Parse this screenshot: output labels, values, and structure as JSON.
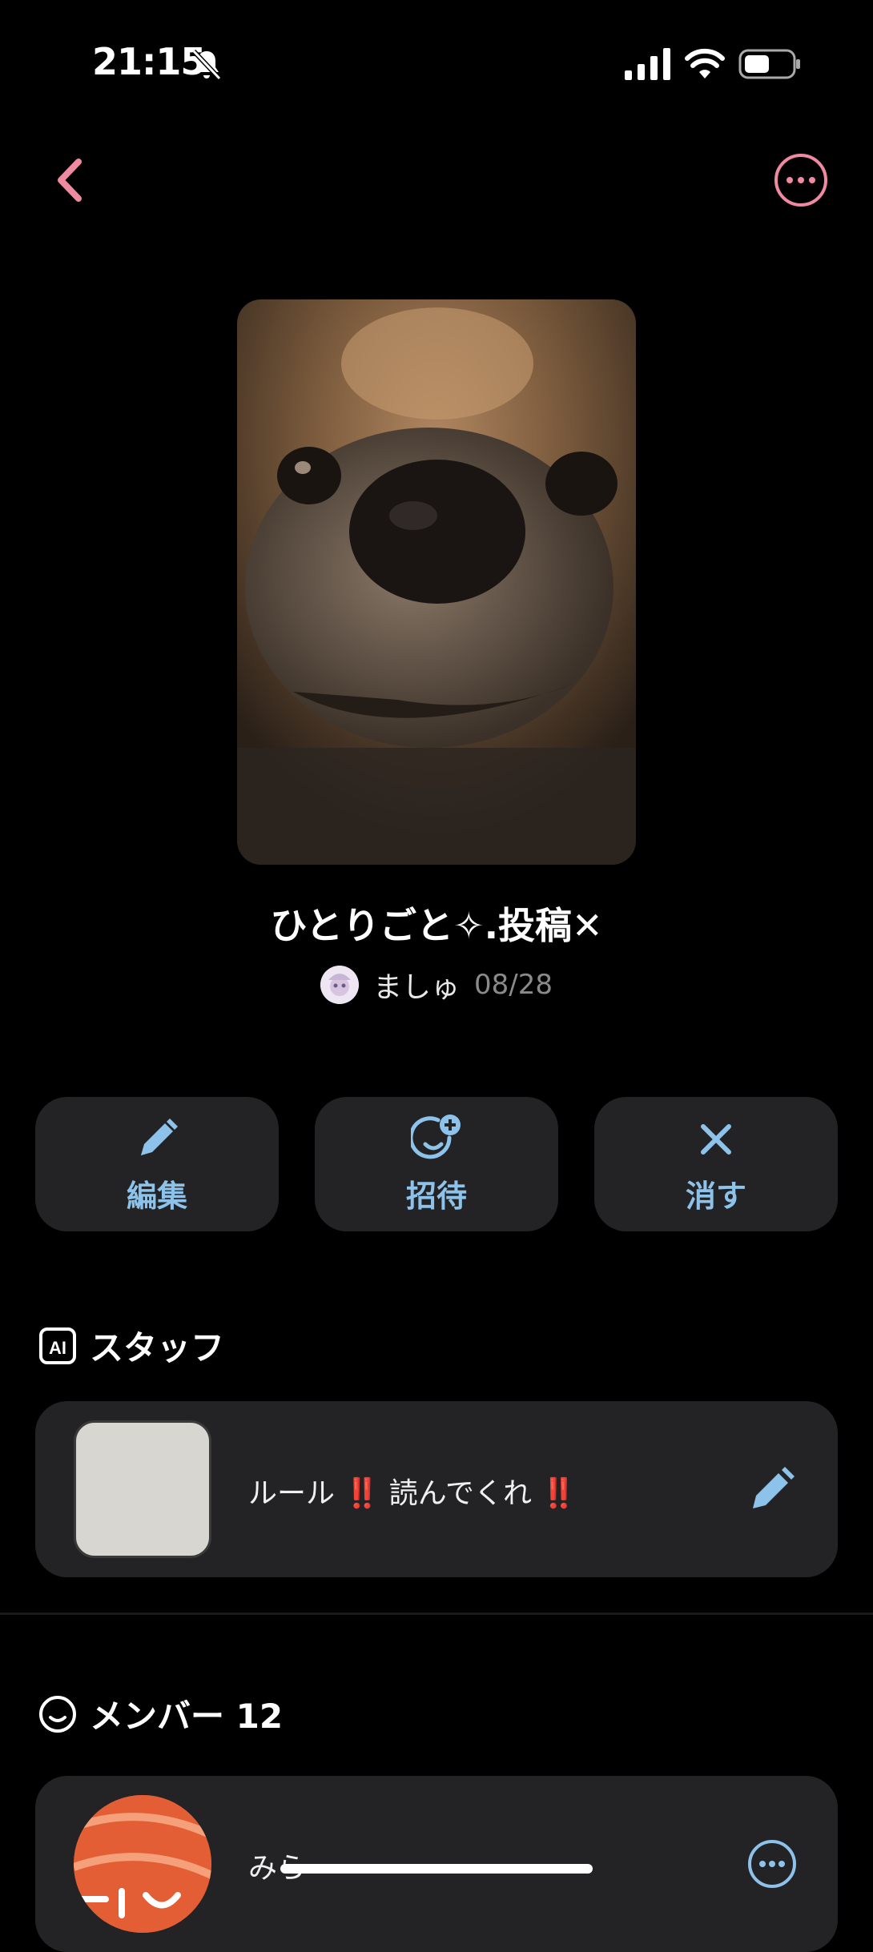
{
  "status_bar": {
    "time": "21:15",
    "battery_level": 0.5
  },
  "icons": {
    "back": "chevron-left-icon",
    "more": "more-horizontal-circle-icon",
    "edit": "pencil-icon",
    "invite": "add-user-smile-icon",
    "delete": "close-icon",
    "ai": "ai-badge-icon",
    "members": "smile-circle-icon"
  },
  "colors": {
    "accent_pink": "#f08aa0",
    "accent_blue": "#8dc3ea",
    "card_bg": "#232325",
    "warning_red": "#e8231f"
  },
  "group": {
    "title": "ひとりごと✧.投稿✕",
    "owner_name": "ましゅ",
    "date": "08/28"
  },
  "actions": [
    {
      "label": "編集"
    },
    {
      "label": "招待"
    },
    {
      "label": "消す"
    }
  ],
  "staff": {
    "heading": "スタッフ",
    "item": {
      "text_pre": "ルール",
      "text_mid": "読んでくれ",
      "emoji": "‼️"
    }
  },
  "members": {
    "heading": "メンバー 12",
    "first": {
      "name": "みら"
    }
  }
}
